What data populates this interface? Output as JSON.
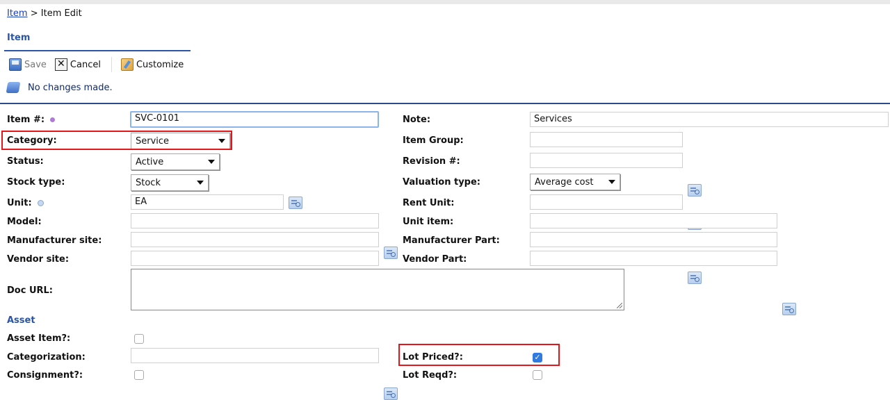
{
  "breadcrumb": {
    "link": "Item",
    "separator": " > ",
    "current": "Item Edit"
  },
  "section": {
    "title": "Item"
  },
  "toolbar": {
    "save_label": "Save",
    "cancel_label": "Cancel",
    "customize_label": "Customize"
  },
  "status": {
    "message": "No changes made."
  },
  "form": {
    "item_no": {
      "label": "Item #:",
      "value": "SVC-0101"
    },
    "category": {
      "label": "Category:",
      "value": "Service"
    },
    "status": {
      "label": "Status:",
      "value": "Active"
    },
    "stock_type": {
      "label": "Stock type:",
      "value": "Stock"
    },
    "unit": {
      "label": "Unit:",
      "value": "EA"
    },
    "model": {
      "label": "Model:",
      "value": ""
    },
    "manufacturer_site": {
      "label": "Manufacturer site:",
      "value": ""
    },
    "vendor_site": {
      "label": "Vendor site:",
      "value": ""
    },
    "doc_url": {
      "label": "Doc URL:",
      "value": ""
    },
    "note": {
      "label": "Note:",
      "value": "Services"
    },
    "item_group": {
      "label": "Item Group:",
      "value": ""
    },
    "revision": {
      "label": "Revision #:",
      "value": ""
    },
    "valuation_type": {
      "label": "Valuation type:",
      "value": "Average cost"
    },
    "rent_unit": {
      "label": "Rent Unit:",
      "value": ""
    },
    "unit_item": {
      "label": "Unit item:",
      "value": ""
    },
    "manufacturer_part": {
      "label": "Manufacturer Part:",
      "value": ""
    },
    "vendor_part": {
      "label": "Vendor Part:",
      "value": ""
    }
  },
  "asset": {
    "title": "Asset",
    "asset_item": {
      "label": "Asset Item?:",
      "checked": false
    },
    "categorization": {
      "label": "Categorization:",
      "value": ""
    },
    "consignment": {
      "label": "Consignment?:",
      "checked": false
    },
    "lot_priced": {
      "label": "Lot Priced?:",
      "checked": true
    },
    "lot_reqd": {
      "label": "Lot Reqd?:",
      "checked": false
    }
  },
  "colors": {
    "accent": "#2a55a8",
    "highlight": "#e3161b",
    "checkbox_checked": "#2f7be0"
  }
}
